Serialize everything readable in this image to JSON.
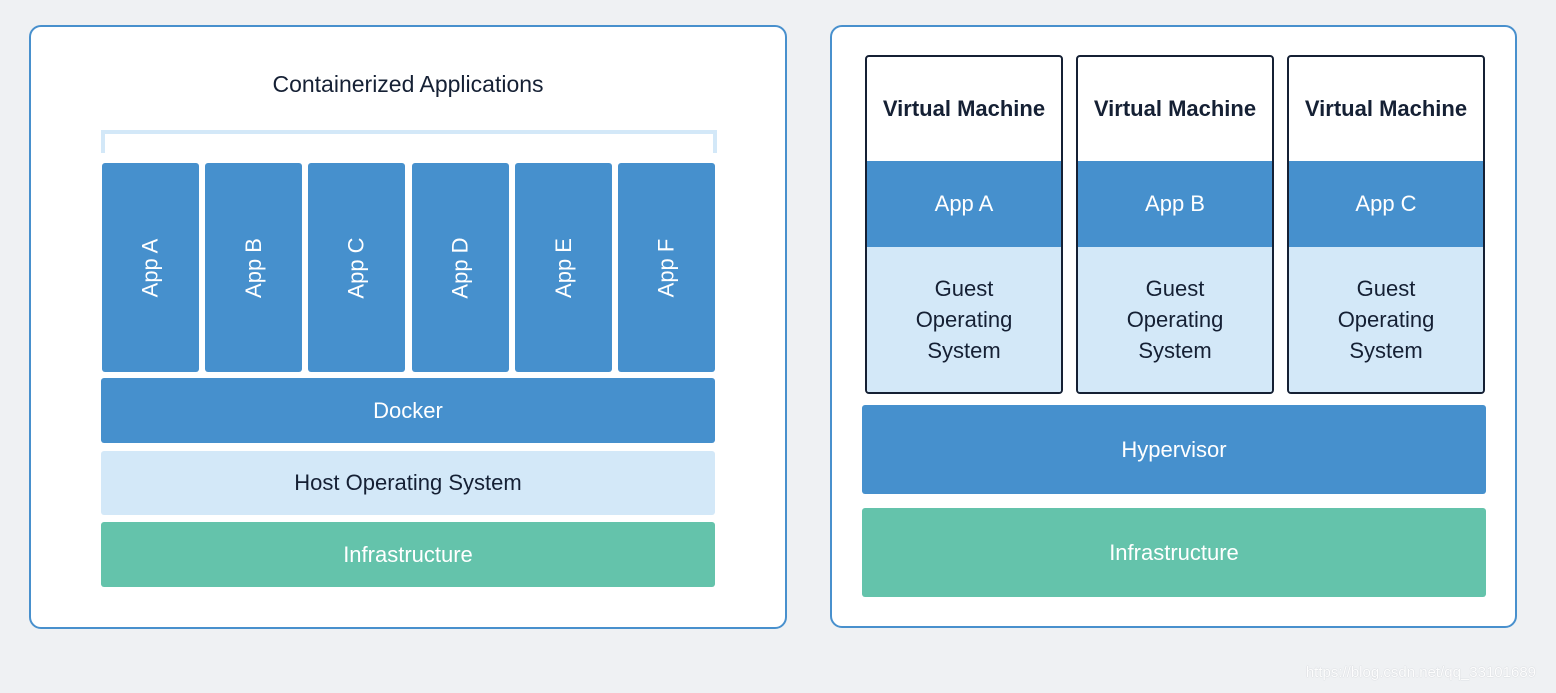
{
  "containers_panel": {
    "title": "Containerized Applications",
    "apps": [
      "App A",
      "App B",
      "App C",
      "App D",
      "App E",
      "App F"
    ],
    "layers": {
      "runtime": "Docker",
      "os": "Host Operating System",
      "infrastructure": "Infrastructure"
    }
  },
  "vms_panel": {
    "vms": [
      {
        "title": "Virtual Machine",
        "app": "App A",
        "os": "Guest Operating System"
      },
      {
        "title": "Virtual Machine",
        "app": "App B",
        "os": "Guest Operating System"
      },
      {
        "title": "Virtual Machine",
        "app": "App C",
        "os": "Guest Operating System"
      }
    ],
    "layers": {
      "hypervisor": "Hypervisor",
      "infrastructure": "Infrastructure"
    }
  },
  "watermark": "https://blog.csdn.net/qq_33101689",
  "colors": {
    "blue": "#4690cd",
    "light_blue": "#d3e8f8",
    "green": "#64c3ab",
    "border": "#4890cd",
    "text_dark": "#152034",
    "background": "#eff1f3"
  }
}
